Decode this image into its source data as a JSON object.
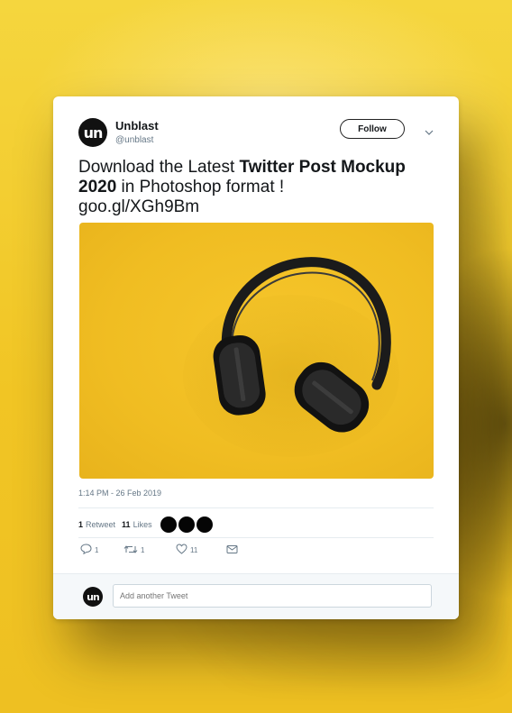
{
  "tweet": {
    "author_name": "Unblast",
    "author_handle": "@unblast",
    "avatar_text": "un",
    "follow_label": "Follow",
    "text_part1": "Download the Latest ",
    "text_bold": "Twitter Post Mockup 2020",
    "text_part2": " in Photoshop format !",
    "link": "goo.gl/XGh9Bm",
    "timestamp": "1:14 PM - 26 Feb 2019",
    "retweet_count": "1",
    "retweet_label": "Retweet",
    "like_count": "11",
    "like_label": "Likes",
    "reply_count": "1",
    "retweet_action_count": "1",
    "like_action_count": "11"
  },
  "reply": {
    "avatar_text": "un",
    "placeholder": "Add another Tweet"
  },
  "icons": {
    "reply": "reply-icon",
    "retweet": "retweet-icon",
    "like": "heart-icon",
    "message": "envelope-icon",
    "caret": "chevron-down-icon"
  },
  "colors": {
    "background": "#f1c524",
    "card": "#ffffff",
    "text": "#14171a",
    "muted": "#657786"
  }
}
